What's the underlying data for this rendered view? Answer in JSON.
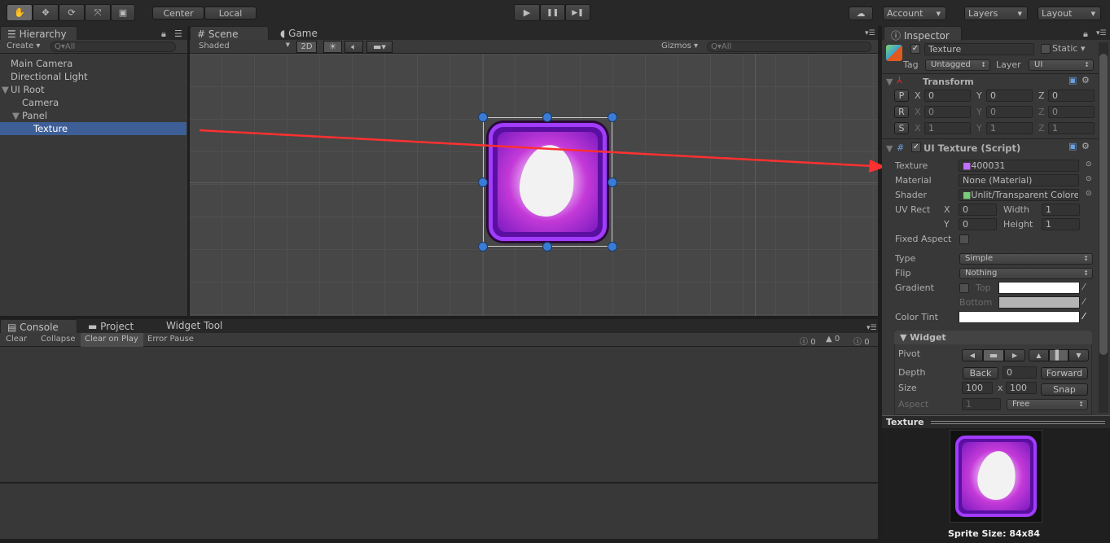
{
  "toolbar": {
    "tools": [
      "hand-icon",
      "move-icon",
      "rotate-icon",
      "scale-icon",
      "rect-icon"
    ],
    "center": "Center",
    "local": "Local",
    "play": "▶",
    "pause": "❚❚",
    "step": "▶❚",
    "account": "Account",
    "layers": "Layers",
    "layout": "Layout"
  },
  "hierarchy": {
    "tab": "Hierarchy",
    "create": "Create",
    "search": "Q▾All",
    "items": [
      {
        "label": "Main Camera",
        "depth": 0
      },
      {
        "label": "Directional Light",
        "depth": 0
      },
      {
        "label": "UI Root",
        "depth": 0,
        "expanded": true
      },
      {
        "label": "Camera",
        "depth": 1
      },
      {
        "label": "Panel",
        "depth": 1,
        "expanded": true
      },
      {
        "label": "Texture",
        "depth": 2,
        "selected": true
      }
    ]
  },
  "scene": {
    "tab_scene": "Scene",
    "tab_game": "Game",
    "shading": "Shaded",
    "mode_2d": "2D",
    "gizmos": "Gizmos",
    "search": "Q▾All"
  },
  "console": {
    "tab_console": "Console",
    "tab_project": "Project",
    "tab_widget": "Widget Tool",
    "clear": "Clear",
    "collapse": "Collapse",
    "clear_on_play": "Clear on Play",
    "error_pause": "Error Pause",
    "log_count": "0",
    "warn_count": "0",
    "error_count": "0"
  },
  "inspector": {
    "tab": "Inspector",
    "name": "Texture",
    "static": "Static",
    "tag_label": "Tag",
    "tag": "Untagged",
    "layer_label": "Layer",
    "layer": "UI",
    "transform": {
      "title": "Transform",
      "rows": [
        {
          "btn": "P",
          "x": "0",
          "y": "0",
          "z": "0"
        },
        {
          "btn": "R",
          "x": "0",
          "y": "0",
          "z": "0"
        },
        {
          "btn": "S",
          "x": "1",
          "y": "1",
          "z": "1"
        }
      ]
    },
    "uitexture": {
      "title": "UI Texture (Script)",
      "texture_label": "Texture",
      "texture": "400031",
      "material_label": "Material",
      "material": "None (Material)",
      "shader_label": "Shader",
      "shader": "Unlit/Transparent Colored",
      "uv_label": "UV Rect",
      "uv_x": "0",
      "uv_y": "0",
      "width_label": "Width",
      "width": "1",
      "height_label": "Height",
      "height": "1",
      "fixed_aspect": "Fixed Aspect",
      "type_label": "Type",
      "type": "Simple",
      "flip_label": "Flip",
      "flip": "Nothing",
      "gradient_label": "Gradient",
      "top": "Top",
      "bottom": "Bottom",
      "tint_label": "Color Tint",
      "top_color": "#ffffff",
      "bottom_color": "#b4b4b4",
      "tint_color": "#ffffff"
    },
    "widget": {
      "title": "Widget",
      "pivot": "Pivot",
      "depth_label": "Depth",
      "back": "Back",
      "depth": "0",
      "forward": "Forward",
      "size_label": "Size",
      "size_w": "100",
      "x": "x",
      "size_h": "100",
      "snap": "Snap",
      "aspect_label": "Aspect",
      "aspect": "1",
      "aspect_mode": "Free"
    },
    "preview": {
      "title": "Texture",
      "caption": "Sprite Size: 84x84"
    }
  },
  "colors": {
    "selection": "#3e5f96",
    "arrow": "#ff3030",
    "handle": "#3a7bd5"
  }
}
